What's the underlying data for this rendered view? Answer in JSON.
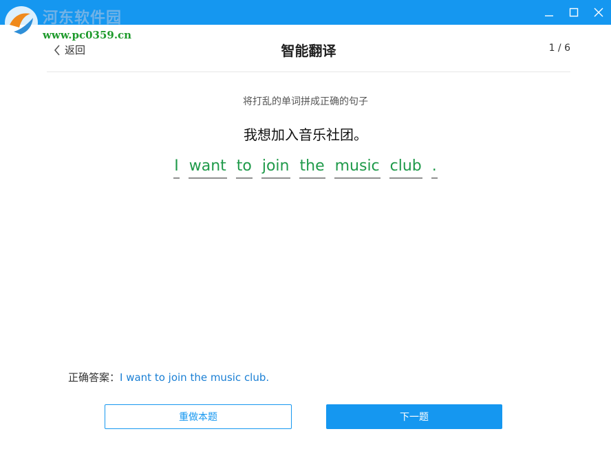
{
  "watermark": {
    "title": "河东软件园",
    "url": "www.pc0359.cn"
  },
  "window_controls": [
    "minimize",
    "maximize",
    "close"
  ],
  "header": {
    "back_label": "返回",
    "title": "智能翻译",
    "page_count": "1 / 6"
  },
  "exercise": {
    "instruction": "将打乱的单词拼成正确的句子",
    "sentence_cn": "我想加入音乐社团。",
    "words": [
      "I",
      "want",
      "to",
      "join",
      "the",
      "music",
      "club",
      "."
    ]
  },
  "answer": {
    "label": "正确答案：",
    "text": "I want to join the music club."
  },
  "buttons": {
    "redo": "重做本题",
    "next": "下一题"
  },
  "colors": {
    "titlebar": "#1597f0",
    "word_text": "#1f9a4a",
    "answer_text": "#1a7fd4",
    "primary": "#1597f0"
  }
}
